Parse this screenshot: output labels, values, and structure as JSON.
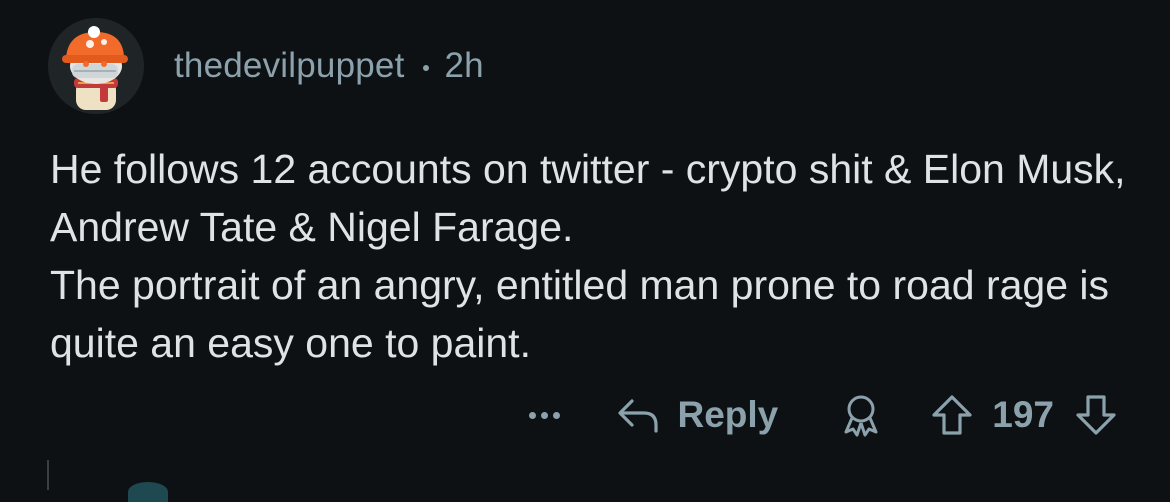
{
  "comment": {
    "author": "thedevilpuppet",
    "time": "2h",
    "paragraphs": [
      "He follows 12 accounts on twitter - crypto shit & Elon Musk, Andrew Tate & Nigel Farage.",
      "The portrait of an angry, entitled man prone to road rage is quite an easy one to paint."
    ],
    "actions": {
      "more_icon": "more-dots-icon",
      "reply_label": "Reply",
      "award_icon": "award-icon",
      "upvote_icon": "arrow-up-icon",
      "score": "197",
      "downvote_icon": "arrow-down-icon"
    }
  },
  "colors": {
    "background": "#0e1113",
    "text": "#dfe3e6",
    "muted": "#8ba2ad",
    "avatar_accent": "#f26b2a"
  }
}
